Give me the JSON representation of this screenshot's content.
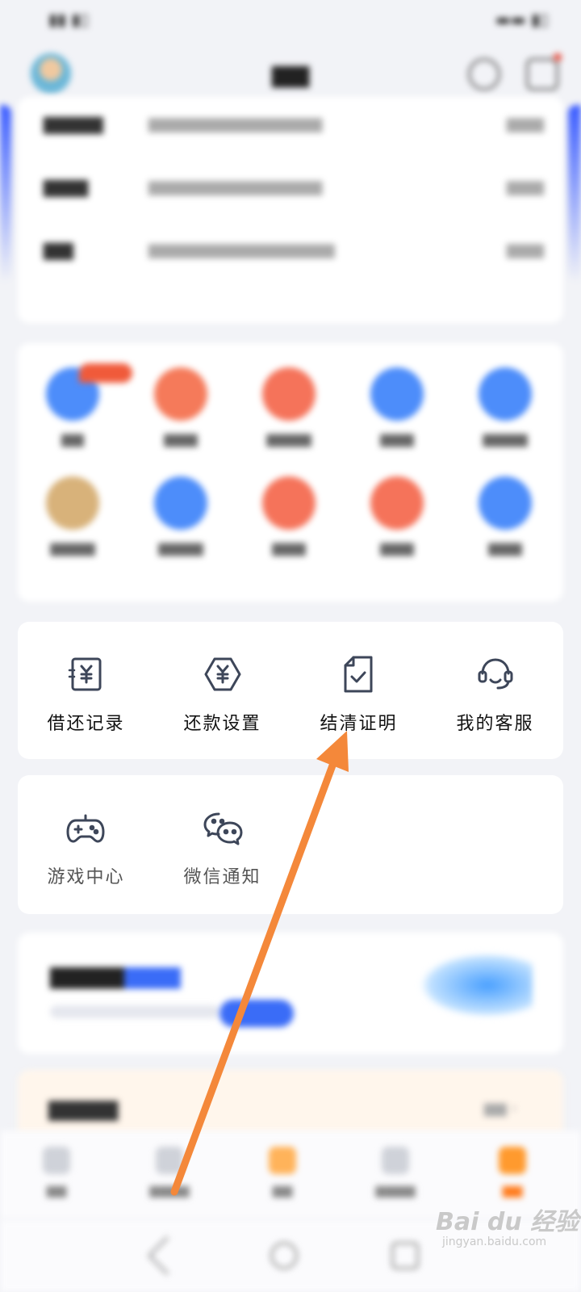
{
  "tools": {
    "items": [
      {
        "label": "借还记录",
        "icon": "receipt-yuan-icon"
      },
      {
        "label": "还款设置",
        "icon": "hexagon-yuan-icon"
      },
      {
        "label": "结清证明",
        "icon": "document-check-icon"
      },
      {
        "label": "我的客服",
        "icon": "headset-icon"
      }
    ]
  },
  "tools2": {
    "items": [
      {
        "label": "游戏中心",
        "icon": "gamepad-icon"
      },
      {
        "label": "微信通知",
        "icon": "wechat-icon"
      }
    ]
  },
  "watermark": {
    "brand": "Bai du 经验",
    "url": "jingyan.baidu.com"
  },
  "colors": {
    "accent": "#3a6cf7",
    "arrow": "#f4883a",
    "icon_stroke": "#3d4659"
  }
}
